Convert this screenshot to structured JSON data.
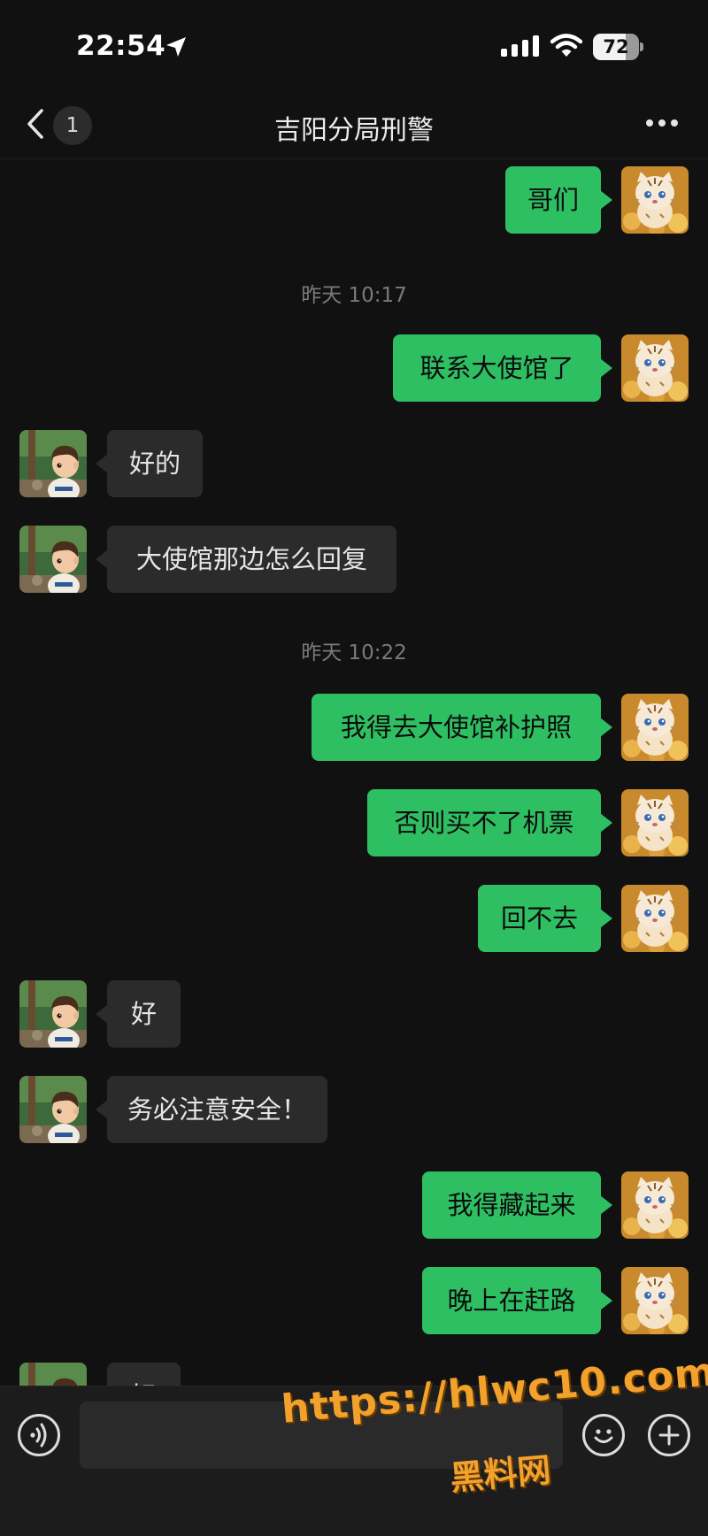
{
  "status_bar": {
    "time": "22:54",
    "battery": "72",
    "battery_level": 0.72
  },
  "nav": {
    "unread_count": "1",
    "title": "吉阳分局刑警"
  },
  "timestamps": [
    "昨天 10:17",
    "昨天 10:22"
  ],
  "messages": [
    {
      "side": "right",
      "text": "哥们",
      "avatar": "tiger-avatar"
    },
    {
      "side": "right",
      "text": "联系大使馆了",
      "avatar": "tiger-avatar"
    },
    {
      "side": "left",
      "text": "好的",
      "avatar": "boy-avatar"
    },
    {
      "side": "left",
      "text": "大使馆那边怎么回复",
      "avatar": "boy-avatar"
    },
    {
      "side": "right",
      "text": "我得去大使馆补护照",
      "avatar": "tiger-avatar"
    },
    {
      "side": "right",
      "text": "否则买不了机票",
      "avatar": "tiger-avatar"
    },
    {
      "side": "right",
      "text": "回不去",
      "avatar": "tiger-avatar"
    },
    {
      "side": "left",
      "text": "好",
      "avatar": "boy-avatar"
    },
    {
      "side": "left",
      "text": "务必注意安全！",
      "avatar": "boy-avatar"
    },
    {
      "side": "right",
      "text": "我得藏起来",
      "avatar": "tiger-avatar"
    },
    {
      "side": "right",
      "text": "晚上在赶路",
      "avatar": "tiger-avatar"
    },
    {
      "side": "left",
      "text": "好",
      "avatar": "boy-avatar"
    }
  ],
  "input_bar": {
    "voice_icon": "voice-icon",
    "emoji_icon": "emoji-icon",
    "plus_icon": "plus-icon"
  },
  "watermark": {
    "url": "https://hlwc10.com",
    "name": "黑料网"
  },
  "colors": {
    "background": "#111111",
    "bubble_self": "#2fbf63",
    "bubble_other": "#2b2b2b",
    "watermark": "#f2a12c"
  }
}
